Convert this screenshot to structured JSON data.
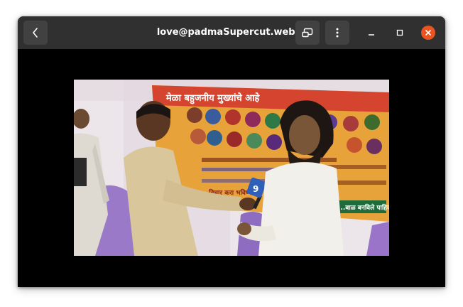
{
  "window": {
    "title": "love@padmaSupercut.webm"
  },
  "header": {
    "back_icon": "chevron-left-icon",
    "pip_icon": "picture-in-picture-icon",
    "menu_icon": "vertical-ellipsis-icon",
    "minimize_icon": "minimize-icon",
    "maximize_icon": "maximize-icon",
    "close_icon": "close-icon"
  },
  "colors": {
    "titlebar": "#303030",
    "button": "#414141",
    "close_accent": "#e95420",
    "banner": "#e8a23a"
  },
  "video": {
    "banner_text": "मेळा बहुजनीय मुख्यांचे आहे",
    "banner_subtext": "...बाळ बनविले पाहिजे",
    "banner_footer": "विचार करा भविष्य",
    "mic_label": "9"
  }
}
